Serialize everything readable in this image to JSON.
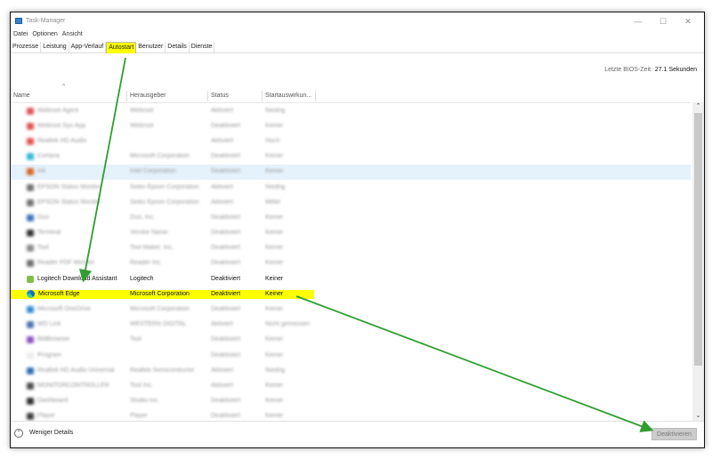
{
  "window": {
    "title": "Task-Manager",
    "min": "—",
    "max": "☐",
    "close": "✕"
  },
  "menu": [
    "Datei",
    "Optionen",
    "Ansicht"
  ],
  "tabs": [
    "Prozesse",
    "Leistung",
    "App-Verlauf",
    "Autostart",
    "Benutzer",
    "Details",
    "Dienste"
  ],
  "active_tab": "Autostart",
  "bios": {
    "label": "Letzte BIOS-Zeit:",
    "value": "27.1 Sekunden"
  },
  "columns": {
    "sort_indicator": "^",
    "name": "Name",
    "publisher": "Herausgeber",
    "status": "Status",
    "impact": "Startauswirkun..."
  },
  "rows": [
    {
      "name": "Webroot Agent",
      "publisher": "Webroot",
      "status": "Aktiviert",
      "impact": "Niedrig",
      "color": "#e05050",
      "blur": true
    },
    {
      "name": "Webroot Sys App",
      "publisher": "Webroot",
      "status": "Deaktiviert",
      "impact": "Keiner",
      "color": "#e05050",
      "blur": true
    },
    {
      "name": "Realtek HD Audio",
      "publisher": "",
      "status": "Aktiviert",
      "impact": "Hoch",
      "color": "#e05050",
      "blur": true
    },
    {
      "name": "Cortana",
      "publisher": "Microsoft Corporation",
      "status": "Deaktiviert",
      "impact": "Keiner",
      "color": "#2db7d6",
      "blur": true
    },
    {
      "name": "Ink",
      "publisher": "Intel Corporation",
      "status": "Deaktiviert",
      "impact": "Keiner",
      "color": "#d4621e",
      "blur": true,
      "sel": true
    },
    {
      "name": "EPSON Status Monitor",
      "publisher": "Seiko Epson Corporation",
      "status": "Aktiviert",
      "impact": "Niedrig",
      "color": "#707070",
      "blur": true
    },
    {
      "name": "EPSON Status Monitor",
      "publisher": "Seiko Epson Corporation",
      "status": "Aktiviert",
      "impact": "Mittel",
      "color": "#707070",
      "blur": true
    },
    {
      "name": "Duo",
      "publisher": "Duo, Inc.",
      "status": "Deaktiviert",
      "impact": "Keiner",
      "color": "#3a6fc0",
      "blur": true
    },
    {
      "name": "Terminal",
      "publisher": "Vendor Name",
      "status": "Deaktiviert",
      "impact": "Keiner",
      "color": "#303030",
      "blur": true
    },
    {
      "name": "Tool",
      "publisher": "Tool Maker, Inc.",
      "status": "Deaktiviert",
      "impact": "Keiner",
      "color": "#888888",
      "blur": true
    },
    {
      "name": "Reader PDF Monitor",
      "publisher": "Reader Inc.",
      "status": "Deaktiviert",
      "impact": "Keiner",
      "color": "#6a6a6a",
      "blur": true
    },
    {
      "name": "Logitech Download Assistant",
      "publisher": "Logitech",
      "status": "Deaktiviert",
      "impact": "Keiner",
      "color": "#7fbf4d",
      "blur": false
    },
    {
      "name": "Microsoft Edge",
      "publisher": "Microsoft Corporation",
      "status": "Deaktiviert",
      "impact": "Keiner",
      "color": "#0a6fc2",
      "blur": false,
      "hl": true,
      "edge": true
    },
    {
      "name": "Microsoft OneDrive",
      "publisher": "Microsoft Corporation",
      "status": "Deaktiviert",
      "impact": "Keiner",
      "color": "#2a8ad8",
      "blur": true
    },
    {
      "name": "WD Link",
      "publisher": "WESTERN DIGITAL",
      "status": "Aktiviert",
      "impact": "Nicht gemessen",
      "color": "#4a6fb0",
      "blur": true
    },
    {
      "name": "Bildbrowser",
      "publisher": "Tool",
      "status": "Deaktiviert",
      "impact": "Keiner",
      "color": "#8a4fc0",
      "blur": true
    },
    {
      "name": "Program",
      "publisher": "",
      "status": "Deaktiviert",
      "impact": "Keiner",
      "color": "#ececec",
      "blur": true
    },
    {
      "name": "Realtek HD Audio Universal",
      "publisher": "Realtek Semiconductor",
      "status": "Aktiviert",
      "impact": "Niedrig",
      "color": "#2a6ab0",
      "blur": true
    },
    {
      "name": "MONITORCONTROLLER",
      "publisher": "Tool Inc.",
      "status": "Aktiviert",
      "impact": "Keiner",
      "color": "#4a4a4a",
      "blur": true
    },
    {
      "name": "Dashboard",
      "publisher": "Studio Inc.",
      "status": "Deaktiviert",
      "impact": "Keiner",
      "color": "#2a2a2a",
      "blur": true
    },
    {
      "name": "Player",
      "publisher": "Player",
      "status": "Deaktiviert",
      "impact": "Keiner",
      "color": "#3a3a3a",
      "blur": true
    }
  ],
  "footer": {
    "less_details": "Weniger Details",
    "deactivate": "Deaktivieren"
  },
  "colors": {
    "highlight": "#ffff00",
    "arrow": "#2e9e2e",
    "selected_row": "#e5f1fb"
  }
}
